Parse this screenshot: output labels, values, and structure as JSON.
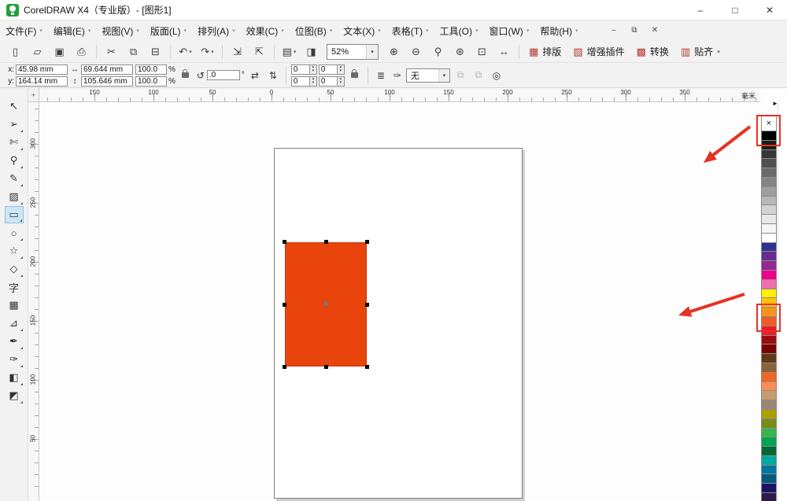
{
  "window": {
    "title": "CorelDRAW X4（专业版）- [图形1]",
    "minimize": "–",
    "maximize": "□",
    "close": "✕",
    "doc_minimize": "–",
    "doc_restore": "⧉",
    "doc_close": "✕"
  },
  "menu": {
    "caret": "▾",
    "items": [
      {
        "name": "file",
        "label": "文件(F)"
      },
      {
        "name": "edit",
        "label": "编辑(E)"
      },
      {
        "name": "view",
        "label": "视图(V)"
      },
      {
        "name": "layout",
        "label": "版面(L)"
      },
      {
        "name": "arrange",
        "label": "排列(A)"
      },
      {
        "name": "effects",
        "label": "效果(C)"
      },
      {
        "name": "bitmaps",
        "label": "位图(B)"
      },
      {
        "name": "text",
        "label": "文本(X)"
      },
      {
        "name": "table",
        "label": "表格(T)"
      },
      {
        "name": "tools",
        "label": "工具(O)"
      },
      {
        "name": "window",
        "label": "窗口(W)"
      },
      {
        "name": "help",
        "label": "帮助(H)"
      }
    ]
  },
  "toolbar": {
    "zoom_value": "52%",
    "caret": "▾",
    "items": [
      {
        "type": "icon",
        "name": "new-document",
        "glyph": "▯"
      },
      {
        "type": "icon",
        "name": "open-document",
        "glyph": "▱"
      },
      {
        "type": "icon",
        "name": "save-document",
        "glyph": "▣"
      },
      {
        "type": "icon",
        "name": "print-document",
        "glyph": "⎙"
      },
      {
        "type": "sep"
      },
      {
        "type": "icon",
        "name": "cut",
        "glyph": "✂"
      },
      {
        "type": "icon",
        "name": "copy",
        "glyph": "⧉"
      },
      {
        "type": "icon",
        "name": "paste",
        "glyph": "⊟"
      },
      {
        "type": "sep"
      },
      {
        "type": "icon",
        "name": "undo",
        "glyph": "↶",
        "caret": true
      },
      {
        "type": "icon",
        "name": "redo",
        "glyph": "↷",
        "caret": true
      },
      {
        "type": "sep"
      },
      {
        "type": "icon",
        "name": "import",
        "glyph": "⇲"
      },
      {
        "type": "icon",
        "name": "export",
        "glyph": "⇱"
      },
      {
        "type": "sep"
      },
      {
        "type": "icon",
        "name": "application-launcher",
        "glyph": "▤",
        "caret": true
      },
      {
        "type": "icon",
        "name": "welcome-screen",
        "glyph": "◨"
      },
      {
        "type": "zoom"
      },
      {
        "type": "icon",
        "name": "zoom-in",
        "glyph": "⊕"
      },
      {
        "type": "icon",
        "name": "zoom-out",
        "glyph": "⊖"
      },
      {
        "type": "icon",
        "name": "zoom-to-selection",
        "glyph": "⚲"
      },
      {
        "type": "icon",
        "name": "zoom-to-all-objects",
        "glyph": "⊛"
      },
      {
        "type": "icon",
        "name": "zoom-to-page",
        "glyph": "⊡"
      },
      {
        "type": "icon",
        "name": "zoom-to-page-width",
        "glyph": "↔"
      },
      {
        "type": "sep"
      },
      {
        "type": "labeled",
        "name": "layout-button",
        "icon": "▦",
        "label": "排版"
      },
      {
        "type": "labeled",
        "name": "plugins-button",
        "icon": "▧",
        "label": "增强插件"
      },
      {
        "type": "labeled",
        "name": "convert-button",
        "icon": "▩",
        "label": "转换"
      },
      {
        "type": "labeled",
        "name": "snap-to-button",
        "icon": "▥",
        "label": "贴齐",
        "caret": true
      }
    ]
  },
  "propbar": {
    "x_label": "x:",
    "x_value": "45.98 mm",
    "y_label": "y:",
    "y_value": "164.14 mm",
    "width_icon": "↔",
    "width_value": "69.644 mm",
    "height_icon": "↕",
    "height_value": "105.646 mm",
    "scale_x": "100.0",
    "scale_y": "100.0",
    "percent": "%",
    "rotate_icon": "↺",
    "angle_value": ".0",
    "degree": "°",
    "mirror_h": "⇄",
    "mirror_v": "⇅",
    "corner_tl": "0",
    "corner_tr": "0",
    "corner_bl": "0",
    "corner_br": "0",
    "spin_up": "▴",
    "spin_down": "▾",
    "wrap_icon": "≣",
    "outline_icon": "✑",
    "outline_value": "无",
    "caret": "▾",
    "layer_icon": "⧉",
    "convert_icon": "◎"
  },
  "rulers": {
    "unit": "毫米",
    "h_labels": [
      "150",
      "100",
      "50",
      "0",
      "50",
      "100",
      "150",
      "200",
      "250",
      "300",
      "350"
    ],
    "v_labels": [
      "300",
      "250",
      "200",
      "150",
      "100",
      "50"
    ]
  },
  "toolbox": {
    "items": [
      {
        "name": "pick-tool",
        "glyph": "↖"
      },
      {
        "name": "shape-tool",
        "glyph": "➢",
        "fly": true
      },
      {
        "name": "crop-tool",
        "glyph": "✄",
        "fly": true
      },
      {
        "name": "zoom-tool",
        "glyph": "⚲",
        "fly": true
      },
      {
        "name": "freehand-tool",
        "glyph": "✎",
        "fly": true
      },
      {
        "name": "smart-fill-tool",
        "glyph": "▨",
        "fly": true
      },
      {
        "name": "rectangle-tool",
        "glyph": "▭",
        "fly": true,
        "active": true
      },
      {
        "name": "ellipse-tool",
        "glyph": "○",
        "fly": true
      },
      {
        "name": "polygon-tool",
        "glyph": "☆",
        "fly": true
      },
      {
        "name": "basic-shapes-tool",
        "glyph": "◇",
        "fly": true
      },
      {
        "name": "text-tool",
        "glyph": "字"
      },
      {
        "name": "table-tool",
        "glyph": "▦"
      },
      {
        "name": "dimension-tool",
        "glyph": "⊿",
        "fly": true
      },
      {
        "name": "eyedropper-tool",
        "glyph": "✒",
        "fly": true
      },
      {
        "name": "outline-pen-tool",
        "glyph": "✑",
        "fly": true
      },
      {
        "name": "fill-tool",
        "glyph": "◧",
        "fly": true
      },
      {
        "name": "interactive-fill-tool",
        "glyph": "◩",
        "fly": true
      }
    ]
  },
  "canvas": {
    "shape_fill": "#e8440c",
    "center_mark": "×"
  },
  "palette": {
    "none_swatch": "×",
    "flyout": "►",
    "colors": [
      "#000000",
      "#1c1c1c",
      "#363636",
      "#505050",
      "#6a6a6a",
      "#848484",
      "#9e9e9e",
      "#b8b8b8",
      "#d2d2d2",
      "#e8e8e8",
      "#f5f5f5",
      "#ffffff",
      "#2e3192",
      "#662d91",
      "#92278f",
      "#ec008c",
      "#f06eaa",
      "#fff200",
      "#ffc20e",
      "#f7941d",
      "#f15a24",
      "#ed1c24",
      "#9e0b0f",
      "#790000",
      "#603913",
      "#8c6239",
      "#f26522",
      "#f68e56",
      "#c69c6d",
      "#998675",
      "#aba000",
      "#7c8a19",
      "#39b54a",
      "#00a651",
      "#006837",
      "#00a99d",
      "#0076a3",
      "#005b7f",
      "#1b1464",
      "#2e1a47"
    ]
  },
  "annotations": {
    "color": "#e53224"
  }
}
